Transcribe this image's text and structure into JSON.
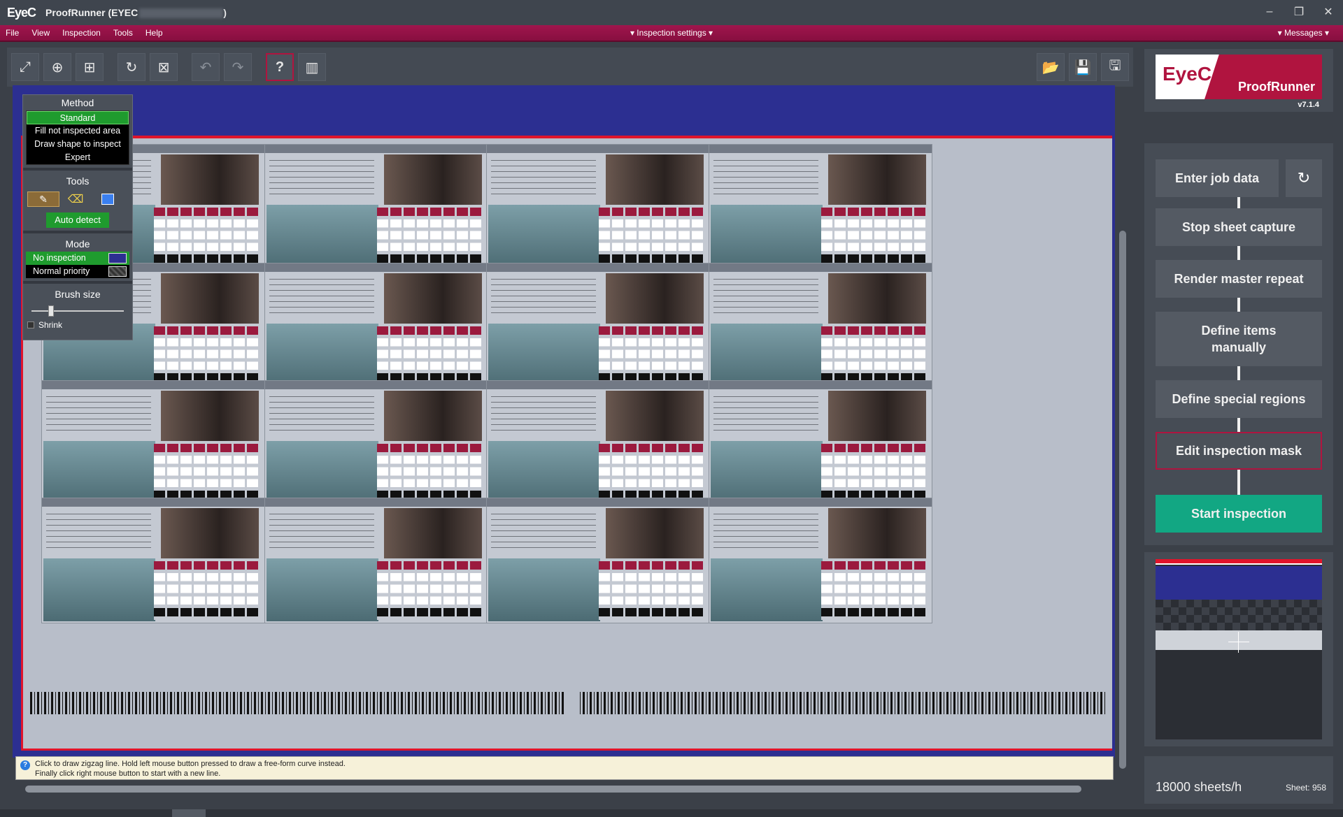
{
  "window": {
    "logo": "EyeC",
    "title": "ProofRunner  (EYEC",
    "controls": [
      "–",
      "❐",
      "✕"
    ]
  },
  "menubar": {
    "items": [
      "File",
      "View",
      "Inspection",
      "Tools",
      "Help"
    ],
    "center": "▾ Inspection settings ▾",
    "right": "▾ Messages ▾"
  },
  "toolbar": {
    "left_icons": [
      "fit-screen-icon",
      "zoom-in-icon",
      "zoom-area-icon",
      "refresh-icon",
      "clear-selection-icon",
      "undo-icon",
      "redo-icon",
      "help-icon",
      "barcode-icon"
    ],
    "help_label": "?",
    "right_icons": [
      "open-folder-icon",
      "save-icon",
      "save-as-icon"
    ]
  },
  "tool_panel": {
    "method_title": "Method",
    "methods": [
      "Standard",
      "Fill not inspected area",
      "Draw shape to inspect",
      "Expert"
    ],
    "method_selected": "Standard",
    "tools_title": "Tools",
    "auto_detect": "Auto detect",
    "mode_title": "Mode",
    "modes": [
      "No inspection",
      "Normal priority"
    ],
    "mode_selected": "No inspection",
    "brush_title": "Brush size",
    "brush_level": 0.15,
    "shrink_label": "Shrink"
  },
  "help_text": {
    "line1": "Click to draw zigzag line. Hold left mouse button pressed to draw a free-form curve instead.",
    "line2": "Finally click right mouse button to start with a new line."
  },
  "brand": {
    "logo_word": "EyeC",
    "product": "ProofRunner",
    "version": "v7.1.4"
  },
  "workflow": {
    "enter_job": "Enter job data",
    "stop_capture": "Stop sheet capture",
    "render_master": "Render master repeat",
    "define_items": "Define items manually",
    "define_regions": "Define special regions",
    "edit_mask": "Edit inspection mask",
    "start": "Start inspection"
  },
  "stats": {
    "rate": "18000 sheets/h",
    "sheet": "Sheet:  958"
  },
  "colors": {
    "brand_red": "#b0143f",
    "start_green": "#12a783",
    "canvas_blue": "#2c2f91"
  }
}
